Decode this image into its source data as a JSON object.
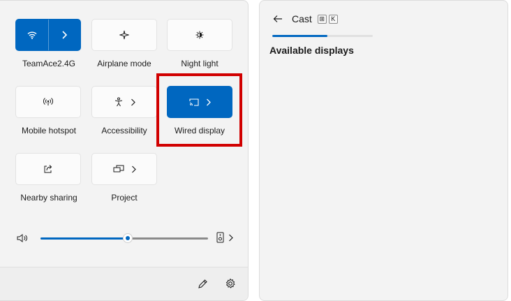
{
  "quick_settings": {
    "tiles": [
      {
        "label": "TeamAce2.4G",
        "icon": "wifi-icon",
        "active": true,
        "has_chevron": true
      },
      {
        "label": "Airplane mode",
        "icon": "airplane-icon",
        "active": false,
        "has_chevron": false
      },
      {
        "label": "Night light",
        "icon": "night-light-icon",
        "active": false,
        "has_chevron": false
      },
      {
        "label": "Mobile hotspot",
        "icon": "hotspot-icon",
        "active": false,
        "has_chevron": false
      },
      {
        "label": "Accessibility",
        "icon": "accessibility-icon",
        "active": false,
        "has_chevron": true
      },
      {
        "label": "Wired display",
        "icon": "cast-icon",
        "active": true,
        "has_chevron": true
      },
      {
        "label": "Nearby sharing",
        "icon": "share-icon",
        "active": false,
        "has_chevron": false
      },
      {
        "label": "Project",
        "icon": "project-icon",
        "active": false,
        "has_chevron": true
      }
    ],
    "volume": {
      "icon": "speaker-icon",
      "level": 0.52,
      "output_icon": "audio-output-icon"
    },
    "footer": {
      "edit_icon": "pencil-icon",
      "settings_icon": "gear-icon"
    }
  },
  "cast": {
    "title": "Cast",
    "shortcut_keys": [
      "⊞",
      "K"
    ],
    "progress": 0.55,
    "section_title": "Available displays"
  },
  "colors": {
    "accent": "#0067c0",
    "highlight": "#d10000",
    "panel": "#f3f3f3"
  }
}
